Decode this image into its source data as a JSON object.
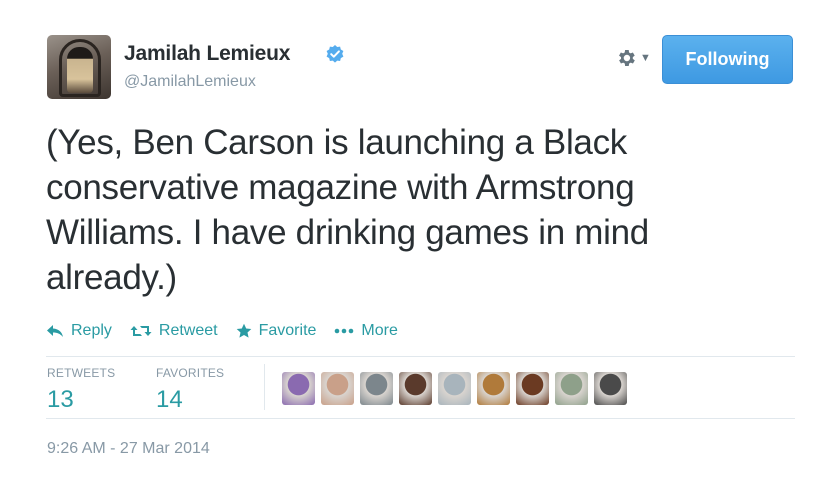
{
  "author": {
    "name": "Jamilah Lemieux",
    "handle": "@JamilahLemieux",
    "verified": true
  },
  "header": {
    "follow_label": "Following"
  },
  "tweet": {
    "text": "(Yes, Ben Carson is launching a Black conservative magazine with Armstrong Williams. I have drinking games in mind already.)"
  },
  "actions": {
    "reply": "Reply",
    "retweet": "Retweet",
    "favorite": "Favorite",
    "more": "More"
  },
  "stats": {
    "retweets_label": "RETWEETS",
    "retweets_count": "13",
    "favorites_label": "FAVORITES",
    "favorites_count": "14"
  },
  "favoriters": [
    {
      "color": "#8a6ab0"
    },
    {
      "color": "#c9a089"
    },
    {
      "color": "#7c868c"
    },
    {
      "color": "#5a3a2c"
    },
    {
      "color": "#a8b4bc"
    },
    {
      "color": "#b07a3a"
    },
    {
      "color": "#6b3a22"
    },
    {
      "color": "#8ea08a"
    },
    {
      "color": "#4a4a4a"
    }
  ],
  "timestamp": "9:26 AM - 27 Mar 2014",
  "colors": {
    "accent": "#2a9ba3",
    "button": "#4aa5eb",
    "muted": "#8899a6",
    "text": "#292f33",
    "verified": "#55acee"
  },
  "icons": {
    "verified": "verified-badge-icon",
    "gear": "gear-icon",
    "reply": "reply-icon",
    "retweet": "retweet-icon",
    "favorite": "star-icon",
    "more": "more-dots-icon"
  }
}
